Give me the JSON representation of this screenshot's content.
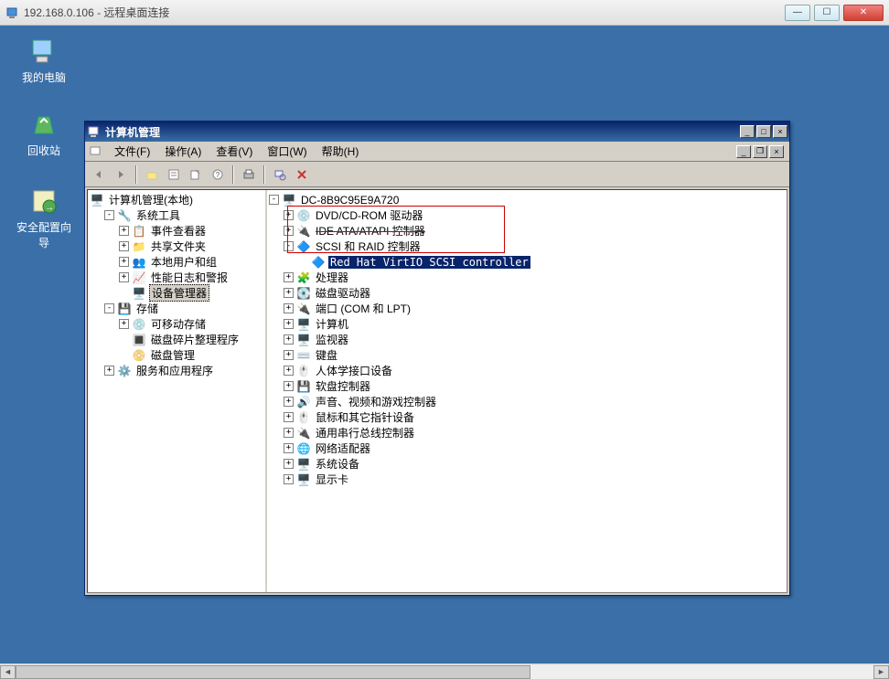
{
  "outer": {
    "title": "192.168.0.106 - 远程桌面连接",
    "btn_min": "—",
    "btn_max": "☐",
    "btn_close": "✕"
  },
  "desktop": {
    "icons": [
      {
        "name": "my-computer",
        "label": "我的电脑"
      },
      {
        "name": "recycle-bin",
        "label": "回收站"
      },
      {
        "name": "security-wizard",
        "label": "安全配置向导"
      }
    ]
  },
  "inner": {
    "title": "计算机管理",
    "caption": {
      "min": "_",
      "max": "□",
      "close": "×"
    },
    "menu": {
      "file": "文件(F)",
      "action": "操作(A)",
      "view": "查看(V)",
      "window": "窗口(W)",
      "help": "帮助(H)"
    },
    "toolbar_hint": "toolbar"
  },
  "left_tree": {
    "root": "计算机管理(本地)",
    "system_tools": "系统工具",
    "event_viewer": "事件查看器",
    "shared_folders": "共享文件夹",
    "local_users": "本地用户和组",
    "perf_logs": "性能日志和警报",
    "device_mgr": "设备管理器",
    "storage": "存储",
    "removable": "可移动存储",
    "defrag": "磁盘碎片整理程序",
    "disk_mgmt": "磁盘管理",
    "services_apps": "服务和应用程序"
  },
  "right_tree": {
    "host": "DC-8B9C95E9A720",
    "dvd": "DVD/CD-ROM 驱动器",
    "ide": "IDE ATA/ATAPI 控制器",
    "scsi": "SCSI 和 RAID 控制器",
    "scsi_child": "Red Hat VirtIO SCSI controller",
    "cpu": "处理器",
    "disk_drives": "磁盘驱动器",
    "ports": "端口 (COM 和 LPT)",
    "computer": "计算机",
    "monitor": "监视器",
    "keyboard": "键盘",
    "hid": "人体学接口设备",
    "floppy_ctrl": "软盘控制器",
    "sound": "声音、视频和游戏控制器",
    "mouse": "鼠标和其它指针设备",
    "usb": "通用串行总线控制器",
    "network": "网络适配器",
    "system_dev": "系统设备",
    "display": "显示卡"
  }
}
